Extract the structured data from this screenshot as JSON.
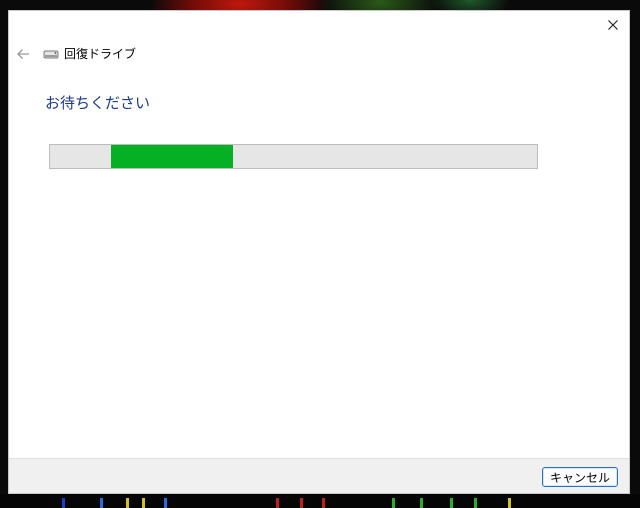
{
  "window": {
    "title": "回復ドライブ",
    "back_icon": "back-arrow-icon",
    "close_icon": "close-icon",
    "drive_icon": "drive-icon"
  },
  "main": {
    "heading": "お待ちください",
    "progress": {
      "style": "marquee",
      "fill_color": "#06b025",
      "track_color": "#e6e6e6"
    }
  },
  "footer": {
    "cancel_label": "キャンセル"
  },
  "colors": {
    "heading": "#1a3a8a",
    "accent_border": "#2a6fc8"
  }
}
